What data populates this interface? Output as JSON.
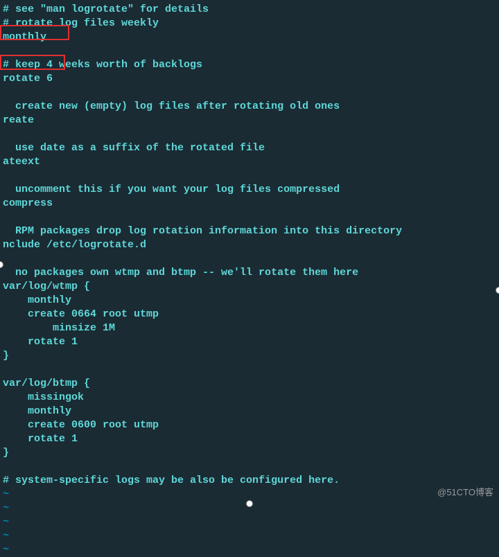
{
  "lines": [
    {
      "text": "# see \"man logrotate\" for details",
      "cls": "comment"
    },
    {
      "text": "# rotate log files weekly",
      "cls": "comment"
    },
    {
      "text": "monthly",
      "cls": "normal"
    },
    {
      "text": "",
      "cls": "normal"
    },
    {
      "text": "# keep 4 weeks worth of backlogs",
      "cls": "comment"
    },
    {
      "text": "rotate 6",
      "cls": "normal"
    },
    {
      "text": "",
      "cls": "normal"
    },
    {
      "text": "  create new (empty) log files after rotating old ones",
      "cls": "comment"
    },
    {
      "text": "reate",
      "cls": "normal"
    },
    {
      "text": "",
      "cls": "normal"
    },
    {
      "text": "  use date as a suffix of the rotated file",
      "cls": "comment"
    },
    {
      "text": "ateext",
      "cls": "normal"
    },
    {
      "text": "",
      "cls": "normal"
    },
    {
      "text": "  uncomment this if you want your log files compressed",
      "cls": "comment"
    },
    {
      "text": "compress",
      "cls": "normal"
    },
    {
      "text": "",
      "cls": "normal"
    },
    {
      "text": "  RPM packages drop log rotation information into this directory",
      "cls": "comment"
    },
    {
      "text": "nclude /etc/logrotate.d",
      "cls": "normal"
    },
    {
      "text": "",
      "cls": "normal"
    },
    {
      "text": "  no packages own wtmp and btmp -- we'll rotate them here",
      "cls": "comment"
    },
    {
      "text": "var/log/wtmp {",
      "cls": "normal"
    },
    {
      "text": "    monthly",
      "cls": "normal"
    },
    {
      "text": "    create 0664 root utmp",
      "cls": "normal"
    },
    {
      "text": "        minsize 1M",
      "cls": "normal"
    },
    {
      "text": "    rotate 1",
      "cls": "normal"
    },
    {
      "text": "}",
      "cls": "normal"
    },
    {
      "text": "",
      "cls": "normal"
    },
    {
      "text": "var/log/btmp {",
      "cls": "normal"
    },
    {
      "text": "    missingok",
      "cls": "normal"
    },
    {
      "text": "    monthly",
      "cls": "normal"
    },
    {
      "text": "    create 0600 root utmp",
      "cls": "normal"
    },
    {
      "text": "    rotate 1",
      "cls": "normal"
    },
    {
      "text": "}",
      "cls": "normal"
    },
    {
      "text": "",
      "cls": "normal"
    },
    {
      "text": "# system-specific logs may be also be configured here.",
      "cls": "comment"
    },
    {
      "text": "~",
      "cls": "tilde"
    },
    {
      "text": "~",
      "cls": "tilde"
    },
    {
      "text": "~",
      "cls": "tilde"
    },
    {
      "text": "~",
      "cls": "tilde"
    },
    {
      "text": "~",
      "cls": "tilde"
    }
  ],
  "watermark": "@51CTO博客"
}
